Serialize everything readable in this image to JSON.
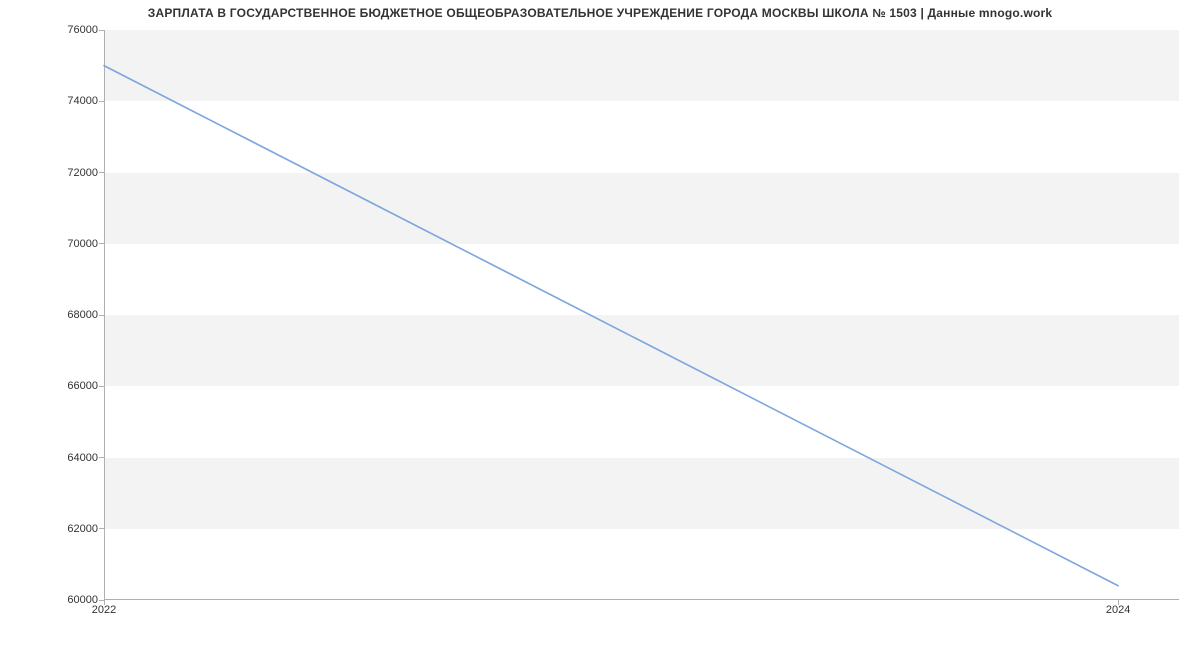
{
  "chart_data": {
    "type": "line",
    "title": "ЗАРПЛАТА В ГОСУДАРСТВЕННОЕ БЮДЖЕТНОЕ ОБЩЕОБРАЗОВАТЕЛЬНОЕ УЧРЕЖДЕНИЕ ГОРОДА МОСКВЫ ШКОЛА № 1503 | Данные mnogo.work",
    "xlabel": "",
    "ylabel": "",
    "x": [
      2022,
      2024
    ],
    "values": [
      75000,
      60400
    ],
    "y_ticks": [
      60000,
      62000,
      64000,
      66000,
      68000,
      70000,
      72000,
      74000,
      76000
    ],
    "x_ticks": [
      2022,
      2024
    ],
    "ylim": [
      60000,
      76000
    ],
    "xlim": [
      2022,
      2024.12
    ],
    "grid_bands": true,
    "series_color": "#7ba6de"
  }
}
